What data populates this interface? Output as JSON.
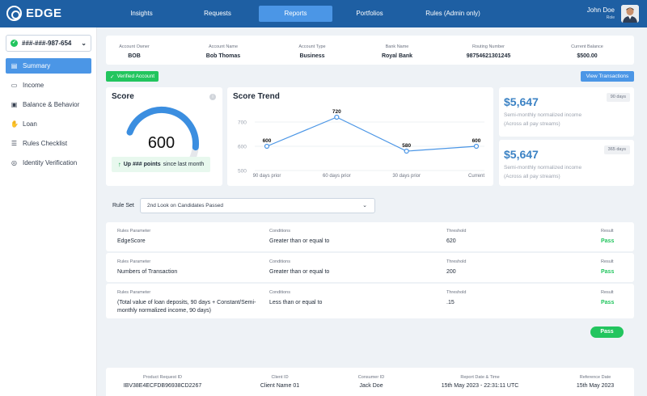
{
  "app": {
    "brand": "EDGE"
  },
  "nav": {
    "tabs": [
      "Insights",
      "Requests",
      "Reports",
      "Portfolios",
      "Rules (Admin only)"
    ],
    "active": "Reports"
  },
  "user": {
    "name": "John Doe",
    "role": "Role"
  },
  "sidebar": {
    "account": "###-###-987-654",
    "items": [
      {
        "label": "Summary",
        "icon": "summary-icon",
        "active": true
      },
      {
        "label": "Income",
        "icon": "income-icon"
      },
      {
        "label": "Balance & Behavior",
        "icon": "balance-icon"
      },
      {
        "label": "Loan",
        "icon": "loan-icon"
      },
      {
        "label": "Rules Checklist",
        "icon": "checklist-icon"
      },
      {
        "label": "Identity Verification",
        "icon": "identity-icon"
      }
    ]
  },
  "account_info": [
    {
      "label": "Account Owner",
      "value": "BOB"
    },
    {
      "label": "Account Name",
      "value": "Bob Thomas"
    },
    {
      "label": "Account Type",
      "value": "Business"
    },
    {
      "label": "Bank Name",
      "value": "Royal Bank"
    },
    {
      "label": "Routing Number",
      "value": "98754621301245"
    },
    {
      "label": "Current Balance",
      "value": "$500.00"
    }
  ],
  "verified_label": "Verified Account",
  "view_transactions_label": "View Transactions",
  "score": {
    "title": "Score",
    "value": "600",
    "fraction": 0.72,
    "note_bold": "Up ### points",
    "note_rest": "since last month",
    "accent": "#3b8ee0"
  },
  "trend": {
    "title": "Score Trend",
    "chart_data": {
      "type": "line",
      "categories": [
        "90 days prior",
        "60 days prior",
        "30 days prior",
        "Current"
      ],
      "values": [
        600,
        720,
        580,
        600
      ],
      "yticks": [
        700,
        600,
        500
      ],
      "ylim": [
        500,
        750
      ]
    }
  },
  "income_cards": [
    {
      "amount": "$5,647",
      "line1": "Semi-monthly normalized income",
      "line2": "(Across all pay streams)",
      "badge": "90 days"
    },
    {
      "amount": "$5,647",
      "line1": "Semi-monthly normalized income",
      "line2": "(Across all pay streams)",
      "badge": "365 days"
    }
  ],
  "ruleset": {
    "label": "Rule Set",
    "value": "2nd Look on Candidates Passed"
  },
  "rules_headers": {
    "param": "Rules Parameter",
    "cond": "Conditions",
    "threshold": "Threshold",
    "result": "Result"
  },
  "rules": [
    {
      "param": "EdgeScore",
      "cond": "Greater than or equal to",
      "threshold": "620",
      "result": "Pass"
    },
    {
      "param": "Numbers of Transaction",
      "cond": "Greater than or equal to",
      "threshold": "200",
      "result": "Pass"
    },
    {
      "param": "(Total value of loan deposits, 90 days + Constant/Semi-monthly normalized income, 90 days)",
      "cond": "Less than or equal to",
      "threshold": ".15",
      "result": "Pass"
    }
  ],
  "overall_result": "Pass",
  "footer": [
    {
      "label": "Product Request ID",
      "value": "IBV38E4ECFDB96938CD2267"
    },
    {
      "label": "Client ID",
      "value": "Client Name 01"
    },
    {
      "label": "Consumer ID",
      "value": "Jack Doe"
    },
    {
      "label": "Report Date & Time",
      "value": "15th May 2023 - 22:31:11 UTC"
    },
    {
      "label": "Reference Date",
      "value": "15th May 2023"
    }
  ]
}
